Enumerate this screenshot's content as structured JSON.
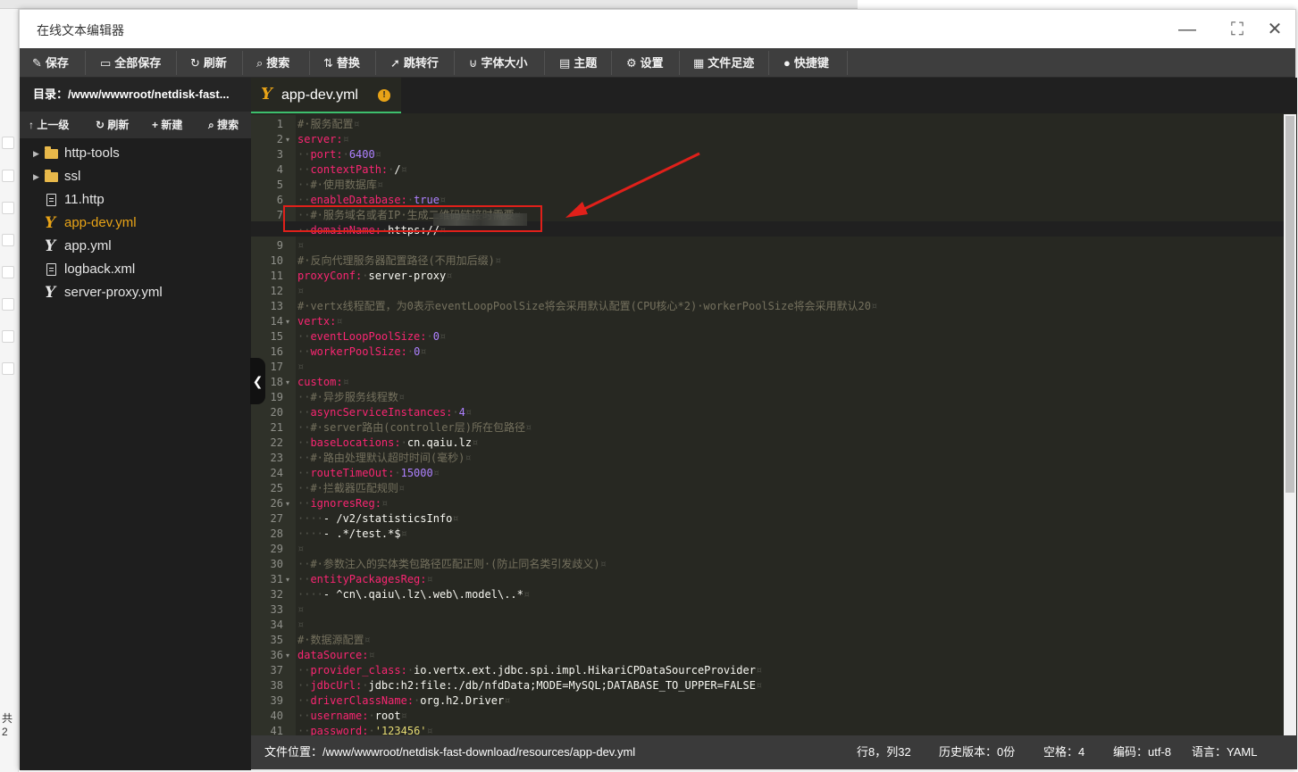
{
  "window": {
    "title": "在线文本编辑器",
    "controls": {
      "minimize": "—",
      "maximize": "⛶",
      "close": "✕"
    }
  },
  "toolbar": [
    {
      "icon": "✎",
      "label": "保存"
    },
    {
      "icon": "▭",
      "label": "全部保存"
    },
    {
      "icon": "↻",
      "label": "刷新"
    },
    {
      "icon": "⌕",
      "label": "搜索"
    },
    {
      "icon": "⇅",
      "label": "替换"
    },
    {
      "icon": "➚",
      "label": "跳转行"
    },
    {
      "icon": "⊍",
      "label": "字体大小"
    },
    {
      "icon": "▤",
      "label": "主题"
    },
    {
      "icon": "⚙",
      "label": "设置"
    },
    {
      "icon": "▦",
      "label": "文件足迹"
    },
    {
      "icon": "●",
      "label": "快捷键"
    }
  ],
  "sidebar": {
    "directory": "目录：/www/wwwroot/netdisk-fast...",
    "actions": [
      {
        "icon": "↑",
        "label": "上一级"
      },
      {
        "icon": "↻",
        "label": "刷新"
      },
      {
        "icon": "+",
        "label": "新建"
      },
      {
        "icon": "⌕",
        "label": "搜索"
      }
    ],
    "files": [
      {
        "name": "http-tools",
        "type": "folder"
      },
      {
        "name": "ssl",
        "type": "folder"
      },
      {
        "name": "11.http",
        "type": "file"
      },
      {
        "name": "app-dev.yml",
        "type": "yaml",
        "active": true
      },
      {
        "name": "app.yml",
        "type": "yaml"
      },
      {
        "name": "logback.xml",
        "type": "file"
      },
      {
        "name": "server-proxy.yml",
        "type": "yaml"
      }
    ]
  },
  "editor": {
    "tab": {
      "name": "app-dev.yml",
      "badge": "!"
    },
    "lines": [
      "# 服务配置",
      "server:",
      "  port: 6400",
      "  contextPath: /",
      "  # 使用数据库",
      "  enableDatabase: true",
      "  # 服务域名或者IP 生成二维码链接时需要",
      "  domainName: https://",
      "",
      "# 反向代理服务器配置路径(不用加后缀)",
      "proxyConf: server-proxy",
      "",
      "# vertx线程配置，为0表示eventLoopPoolSize将会采用默认配置(CPU核心*2) workerPoolSize将会采用默认20",
      "vertx:",
      "  eventLoopPoolSize: 0",
      "  workerPoolSize: 0",
      "",
      "custom:",
      "  # 异步服务线程数",
      "  asyncServiceInstances: 4",
      "  # server路由(controller层)所在包路径",
      "  baseLocations: cn.qaiu.lz",
      "  # 路由处理默认超时时间(毫秒)",
      "  routeTimeOut: 15000",
      "  # 拦截器匹配规则",
      "  ignoresReg:",
      "    - /v2/statisticsInfo",
      "    - .*/test.*$",
      "",
      "  # 参数注入的实体类包路径匹配正则 (防止同名类引发歧义)",
      "  entityPackagesReg:",
      "    - ^cn\\.qaiu\\.lz\\.web\\.model\\..*",
      "",
      "",
      "# 数据源配置",
      "dataSource:",
      "  provider_class: io.vertx.ext.jdbc.spi.impl.HikariCPDataSourceProvider",
      "  jdbcUrl: jdbc:h2:file:./db/nfdData;MODE=MySQL;DATABASE_TO_UPPER=FALSE",
      "  driverClassName: org.h2.Driver",
      "  username: root",
      "  password: '123456'"
    ],
    "fold_lines": [
      2,
      14,
      18,
      26,
      31,
      36
    ]
  },
  "status": {
    "path": "文件位置：/www/wwwroot/netdisk-fast-download/resources/app-dev.yml",
    "cursor": "行8，列32",
    "history": "历史版本：0份",
    "indent": "空格：4",
    "encoding": "编码：utf-8",
    "language": "语言：YAML"
  },
  "background": {
    "left_text": "共2"
  },
  "colors": {
    "key": "#f92672",
    "comment": "#75715e",
    "number": "#ae81ff",
    "string": "#e6db74",
    "annotation": "#e0201a",
    "active_file": "#e8a317",
    "tab_underline": "#3dbf6d"
  }
}
